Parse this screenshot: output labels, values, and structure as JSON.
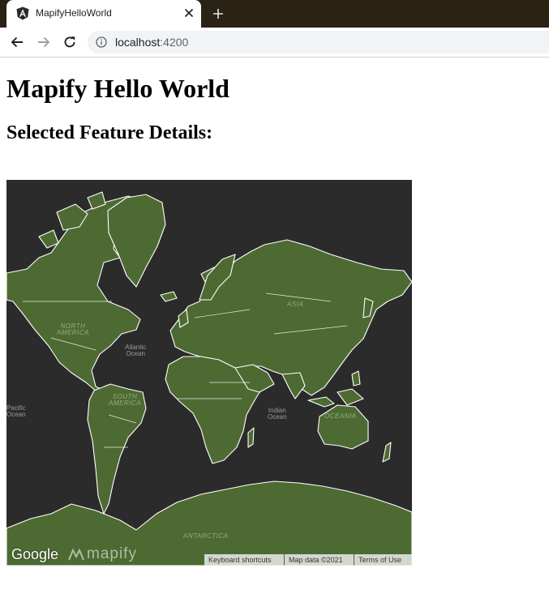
{
  "browser": {
    "tab_title": "MapifyHelloWorld",
    "url_host": "localhost",
    "url_port": ":4200",
    "colors": {
      "tabstrip": "#2a2212",
      "omnibox": "#f1f3f4"
    }
  },
  "page": {
    "title": "Mapify Hello World",
    "subtitle": "Selected Feature Details:"
  },
  "map": {
    "colors": {
      "ocean": "#2b2b2b",
      "land": "#4e6a33",
      "borders": "#ffffff"
    },
    "oceans": [
      {
        "line1": "Atlantic",
        "line2": "Ocean"
      },
      {
        "line1": "Indian",
        "line2": "Ocean"
      },
      {
        "line1": "Pacific",
        "line2": "Ocean"
      }
    ],
    "continents": [
      "NORTH",
      "AMERICA",
      "SOUTH",
      "AMERICA",
      "ASIA",
      "OCEANIA",
      "ANTARCTICA"
    ],
    "logos": {
      "google": "Google",
      "mapify": "mapify"
    },
    "attribution": {
      "shortcuts": "Keyboard shortcuts",
      "data": "Map data ©2021",
      "terms": "Terms of Use"
    }
  }
}
